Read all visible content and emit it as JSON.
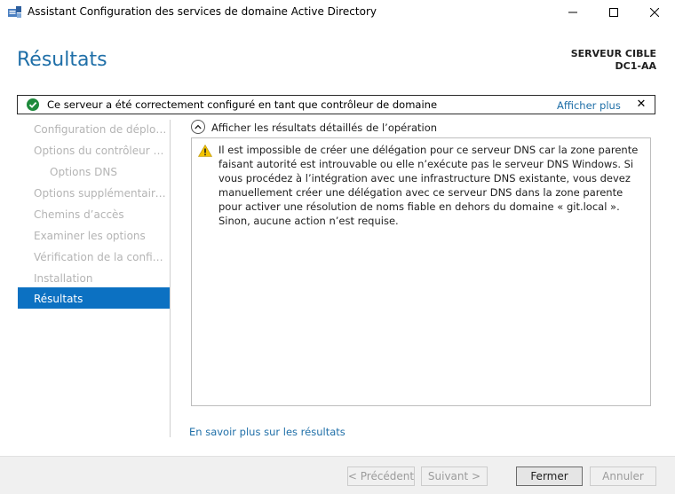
{
  "window": {
    "title": "Assistant Configuration des services de domaine Active Directory"
  },
  "header": {
    "page_title": "Résultats",
    "target_label": "SERVEUR CIBLE",
    "target_server": "DC1-AA"
  },
  "banner": {
    "message": "Ce serveur a été correctement configuré en tant que contrôleur de domaine",
    "more_link": "Afficher plus",
    "close_glyph": "✕",
    "status_color": "#1e8a3c"
  },
  "nav": {
    "items": [
      {
        "label": "Configuration de déploie..."
      },
      {
        "label": "Options du contrôleur de..."
      },
      {
        "label": "Options DNS"
      },
      {
        "label": "Options supplémentaires"
      },
      {
        "label": "Chemins d’accès"
      },
      {
        "label": "Examiner les options"
      },
      {
        "label": "Vérification de la configur..."
      },
      {
        "label": "Installation"
      },
      {
        "label": "Résultats"
      }
    ],
    "active_color": "#0c71c2"
  },
  "details": {
    "expander_label": "Afficher les résultats détaillés de l’opération",
    "warning_text": "Il est impossible de créer une délégation pour ce serveur DNS car la zone parente faisant autorité est introuvable ou elle n’exécute pas le serveur DNS Windows. Si vous procédez à l’intégration avec une infrastructure DNS existante, vous devez manuellement créer une délégation avec ce serveur DNS dans la zone parente pour activer une résolution de noms fiable en dehors du domaine « git.local ». Sinon, aucune action n’est requise."
  },
  "learn_more": "En savoir plus sur les résultats",
  "footer": {
    "prev_label": "< Précédent",
    "next_label": "Suivant >",
    "close_label": "Fermer",
    "cancel_label": "Annuler"
  }
}
